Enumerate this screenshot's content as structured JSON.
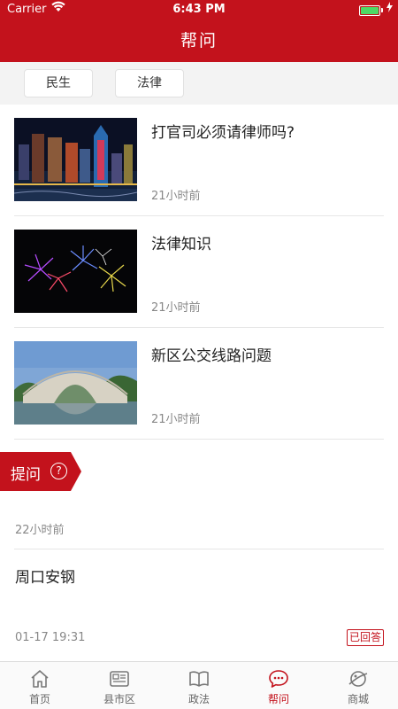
{
  "status_bar": {
    "carrier": "Carrier",
    "time": "6:43 PM",
    "battery_level": 1.0
  },
  "nav": {
    "title": "帮问"
  },
  "categories": [
    {
      "label": "民生"
    },
    {
      "label": "法律"
    }
  ],
  "news": [
    {
      "title": "打官司必须请律师吗?",
      "time": "21小时前",
      "image": "city-night-skyline"
    },
    {
      "title": "法律知识",
      "time": "21小时前",
      "image": "fireworks"
    },
    {
      "title": "新区公交线路问题",
      "time": "21小时前",
      "image": "arch-bridge"
    }
  ],
  "ask_button": {
    "label": "提问",
    "icon": "question-circle-icon"
  },
  "question_feed": {
    "first_time": "22小时前",
    "item": {
      "title": "周口安钢",
      "date": "01-17 19:31",
      "status": "已回答"
    }
  },
  "tabbar": [
    {
      "label": "首页",
      "icon": "home-icon"
    },
    {
      "label": "县市区",
      "icon": "newspaper-icon"
    },
    {
      "label": "政法",
      "icon": "book-icon"
    },
    {
      "label": "帮问",
      "icon": "chat-bubble-icon",
      "active": true
    },
    {
      "label": "商城",
      "icon": "planet-icon"
    }
  ],
  "colors": {
    "brand": "#c3121c",
    "text": "#222222",
    "muted": "#888888"
  }
}
